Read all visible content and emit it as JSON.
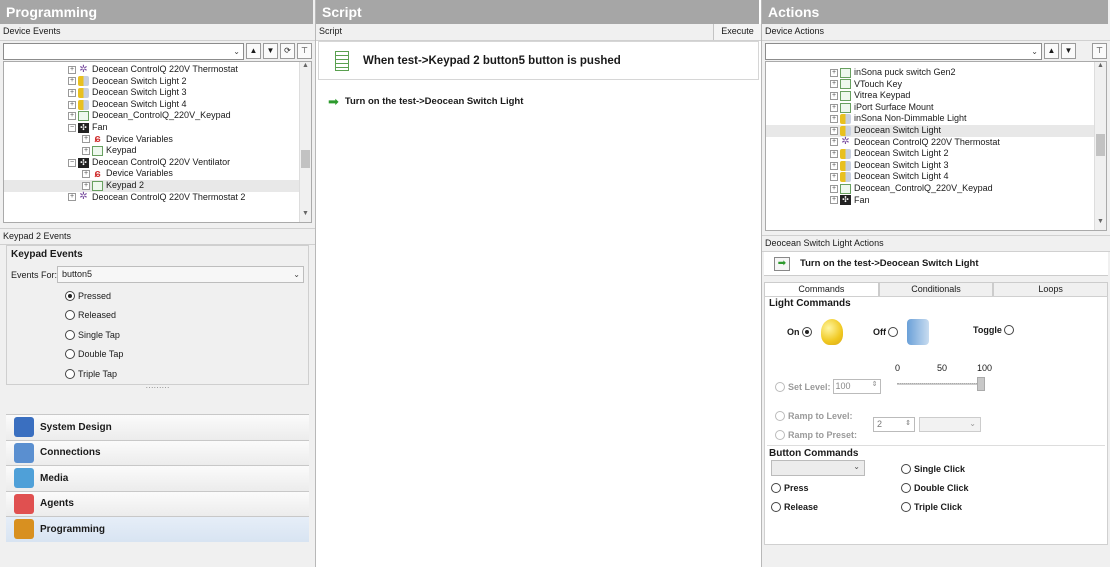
{
  "programming": {
    "title": "Programming",
    "device_events_label": "Device Events",
    "tree": [
      {
        "label": "Deocean ControlQ 220V Thermostat",
        "icon": "thermostat-icon",
        "indent": 1
      },
      {
        "label": "Deocean Switch Light 2",
        "icon": "light-switch-icon",
        "indent": 1
      },
      {
        "label": "Deocean Switch Light 3",
        "icon": "light-switch-icon",
        "indent": 1
      },
      {
        "label": "Deocean Switch Light 4",
        "icon": "light-switch-icon",
        "indent": 1
      },
      {
        "label": "Deocean_ControlQ_220V_Keypad",
        "icon": "keypad-icon",
        "indent": 1
      },
      {
        "label": "Fan",
        "icon": "fan-icon",
        "indent": 1
      },
      {
        "label": "Device Variables",
        "icon": "variables-icon",
        "indent": 2
      },
      {
        "label": "Keypad",
        "icon": "keypad-icon",
        "indent": 2
      },
      {
        "label": "Deocean ControlQ 220V Ventilator",
        "icon": "fan-icon",
        "indent": 1
      },
      {
        "label": "Device Variables",
        "icon": "variables-icon",
        "indent": 2
      },
      {
        "label": "Keypad 2",
        "icon": "keypad-icon",
        "indent": 2,
        "selected": true
      },
      {
        "label": "Deocean ControlQ 220V Thermostat 2",
        "icon": "thermostat-icon",
        "indent": 1
      }
    ],
    "events_header": "Keypad 2 Events",
    "keypad_events_title": "Keypad Events",
    "events_for_label": "Events For:",
    "events_for_value": "button5",
    "event_options": [
      {
        "label": "Pressed",
        "checked": true
      },
      {
        "label": "Released",
        "checked": false
      },
      {
        "label": "Single Tap",
        "checked": false
      },
      {
        "label": "Double Tap",
        "checked": false
      },
      {
        "label": "Triple Tap",
        "checked": false
      }
    ],
    "nav": [
      {
        "label": "System Design",
        "icon": "system-design-icon",
        "color": "#3a6fc0"
      },
      {
        "label": "Connections",
        "icon": "connections-icon",
        "color": "#5a8fd0"
      },
      {
        "label": "Media",
        "icon": "media-icon",
        "color": "#4fa0d8"
      },
      {
        "label": "Agents",
        "icon": "agents-icon",
        "color": "#e05050"
      },
      {
        "label": "Programming",
        "icon": "programming-icon",
        "color": "#d89020",
        "active": true
      }
    ]
  },
  "script": {
    "title": "Script",
    "sub_label": "Script",
    "execute_label": "Execute",
    "trigger_text": "When test->Keypad 2 button5 button is pushed",
    "action_text": "Turn on the test->Deocean Switch Light"
  },
  "actions": {
    "title": "Actions",
    "device_actions_label": "Device Actions",
    "tree": [
      {
        "label": "inSona puck switch Gen2",
        "icon": "keypad-icon"
      },
      {
        "label": "VTouch Key",
        "icon": "keypad-icon"
      },
      {
        "label": "Vitrea Keypad",
        "icon": "keypad-icon"
      },
      {
        "label": "iPort Surface Mount",
        "icon": "keypad-icon"
      },
      {
        "label": "inSona Non-Dimmable Light",
        "icon": "light-switch-icon"
      },
      {
        "label": "Deocean Switch Light",
        "icon": "light-switch-icon",
        "selected": true
      },
      {
        "label": "Deocean ControlQ 220V Thermostat",
        "icon": "thermostat-icon"
      },
      {
        "label": "Deocean Switch Light 2",
        "icon": "light-switch-icon"
      },
      {
        "label": "Deocean Switch Light 3",
        "icon": "light-switch-icon"
      },
      {
        "label": "Deocean Switch Light 4",
        "icon": "light-switch-icon"
      },
      {
        "label": "Deocean_ControlQ_220V_Keypad",
        "icon": "keypad-icon"
      },
      {
        "label": "Fan",
        "icon": "fan-icon"
      }
    ],
    "device_actions_header": "Deocean Switch Light Actions",
    "action_text": "Turn on the test->Deocean Switch Light",
    "tabs": [
      "Commands",
      "Conditionals",
      "Loops"
    ],
    "light_commands_title": "Light Commands",
    "on_label": "On",
    "off_label": "Off",
    "toggle_label": "Toggle",
    "set_level_label": "Set Level:",
    "set_level_value": "100",
    "slider_ticks": [
      "0",
      "50",
      "100"
    ],
    "slider_level": 1.0,
    "ramp_to_level_label": "Ramp to Level:",
    "ramp_to_preset_label": "Ramp to Preset:",
    "ramp_value": "2",
    "button_commands_title": "Button Commands",
    "press_label": "Press",
    "release_label": "Release",
    "single_click_label": "Single Click",
    "double_click_label": "Double Click",
    "triple_click_label": "Triple Click"
  }
}
